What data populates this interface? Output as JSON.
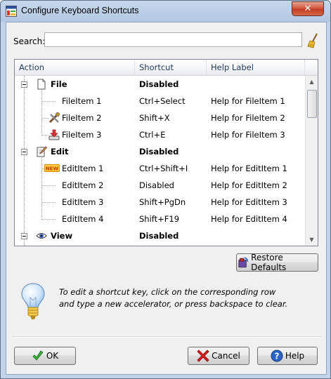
{
  "window": {
    "title": "Configure Keyboard Shortcuts",
    "close_glyph": "✕"
  },
  "search": {
    "label": "Search:",
    "value": "",
    "placeholder": ""
  },
  "table": {
    "columns": [
      "Action",
      "Shortcut",
      "Help Label"
    ],
    "rows": [
      {
        "action": "File",
        "shortcut": "Disabled",
        "help": "",
        "group": true,
        "icon": "file-icon"
      },
      {
        "action": "FileItem 1",
        "shortcut": "Ctrl+Select",
        "help": "Help for FileItem 1",
        "icon": ""
      },
      {
        "action": "FileItem 2",
        "shortcut": "Shift+X",
        "help": "Help for FileItem 2",
        "icon": "tools-icon"
      },
      {
        "action": "FileItem 3",
        "shortcut": "Ctrl+E",
        "help": "Help for FileItem 3",
        "icon": "download-icon"
      },
      {
        "action": "Edit",
        "shortcut": "Disabled",
        "help": "",
        "group": true,
        "icon": "edit-icon"
      },
      {
        "action": "EditItem 1",
        "shortcut": "Ctrl+Shift+I",
        "help": "Help for EditItem 1",
        "icon": "new-icon"
      },
      {
        "action": "EditItem 2",
        "shortcut": "Disabled",
        "help": "Help for EditItem 2",
        "icon": ""
      },
      {
        "action": "EditItem 3",
        "shortcut": "Shift+PgDn",
        "help": "Help for EditItem 3",
        "icon": ""
      },
      {
        "action": "EditItem 4",
        "shortcut": "Shift+F19",
        "help": "Help for EditItem 4",
        "icon": ""
      },
      {
        "action": "View",
        "shortcut": "Disabled",
        "help": "",
        "group": true,
        "icon": "eye-icon"
      }
    ],
    "new_badge": "NEW"
  },
  "buttons": {
    "restore_defaults": "Restore Defaults",
    "ok": "OK",
    "cancel": "Cancel",
    "help": "Help"
  },
  "info": {
    "line1": "To edit a shortcut key, click on the corresponding row",
    "line2": "and type a new accelerator, or press backspace to clear."
  },
  "colors": {
    "titlebar": "#c5d7ec",
    "close_red": "#c23b21",
    "header_text": "#1e395b"
  }
}
